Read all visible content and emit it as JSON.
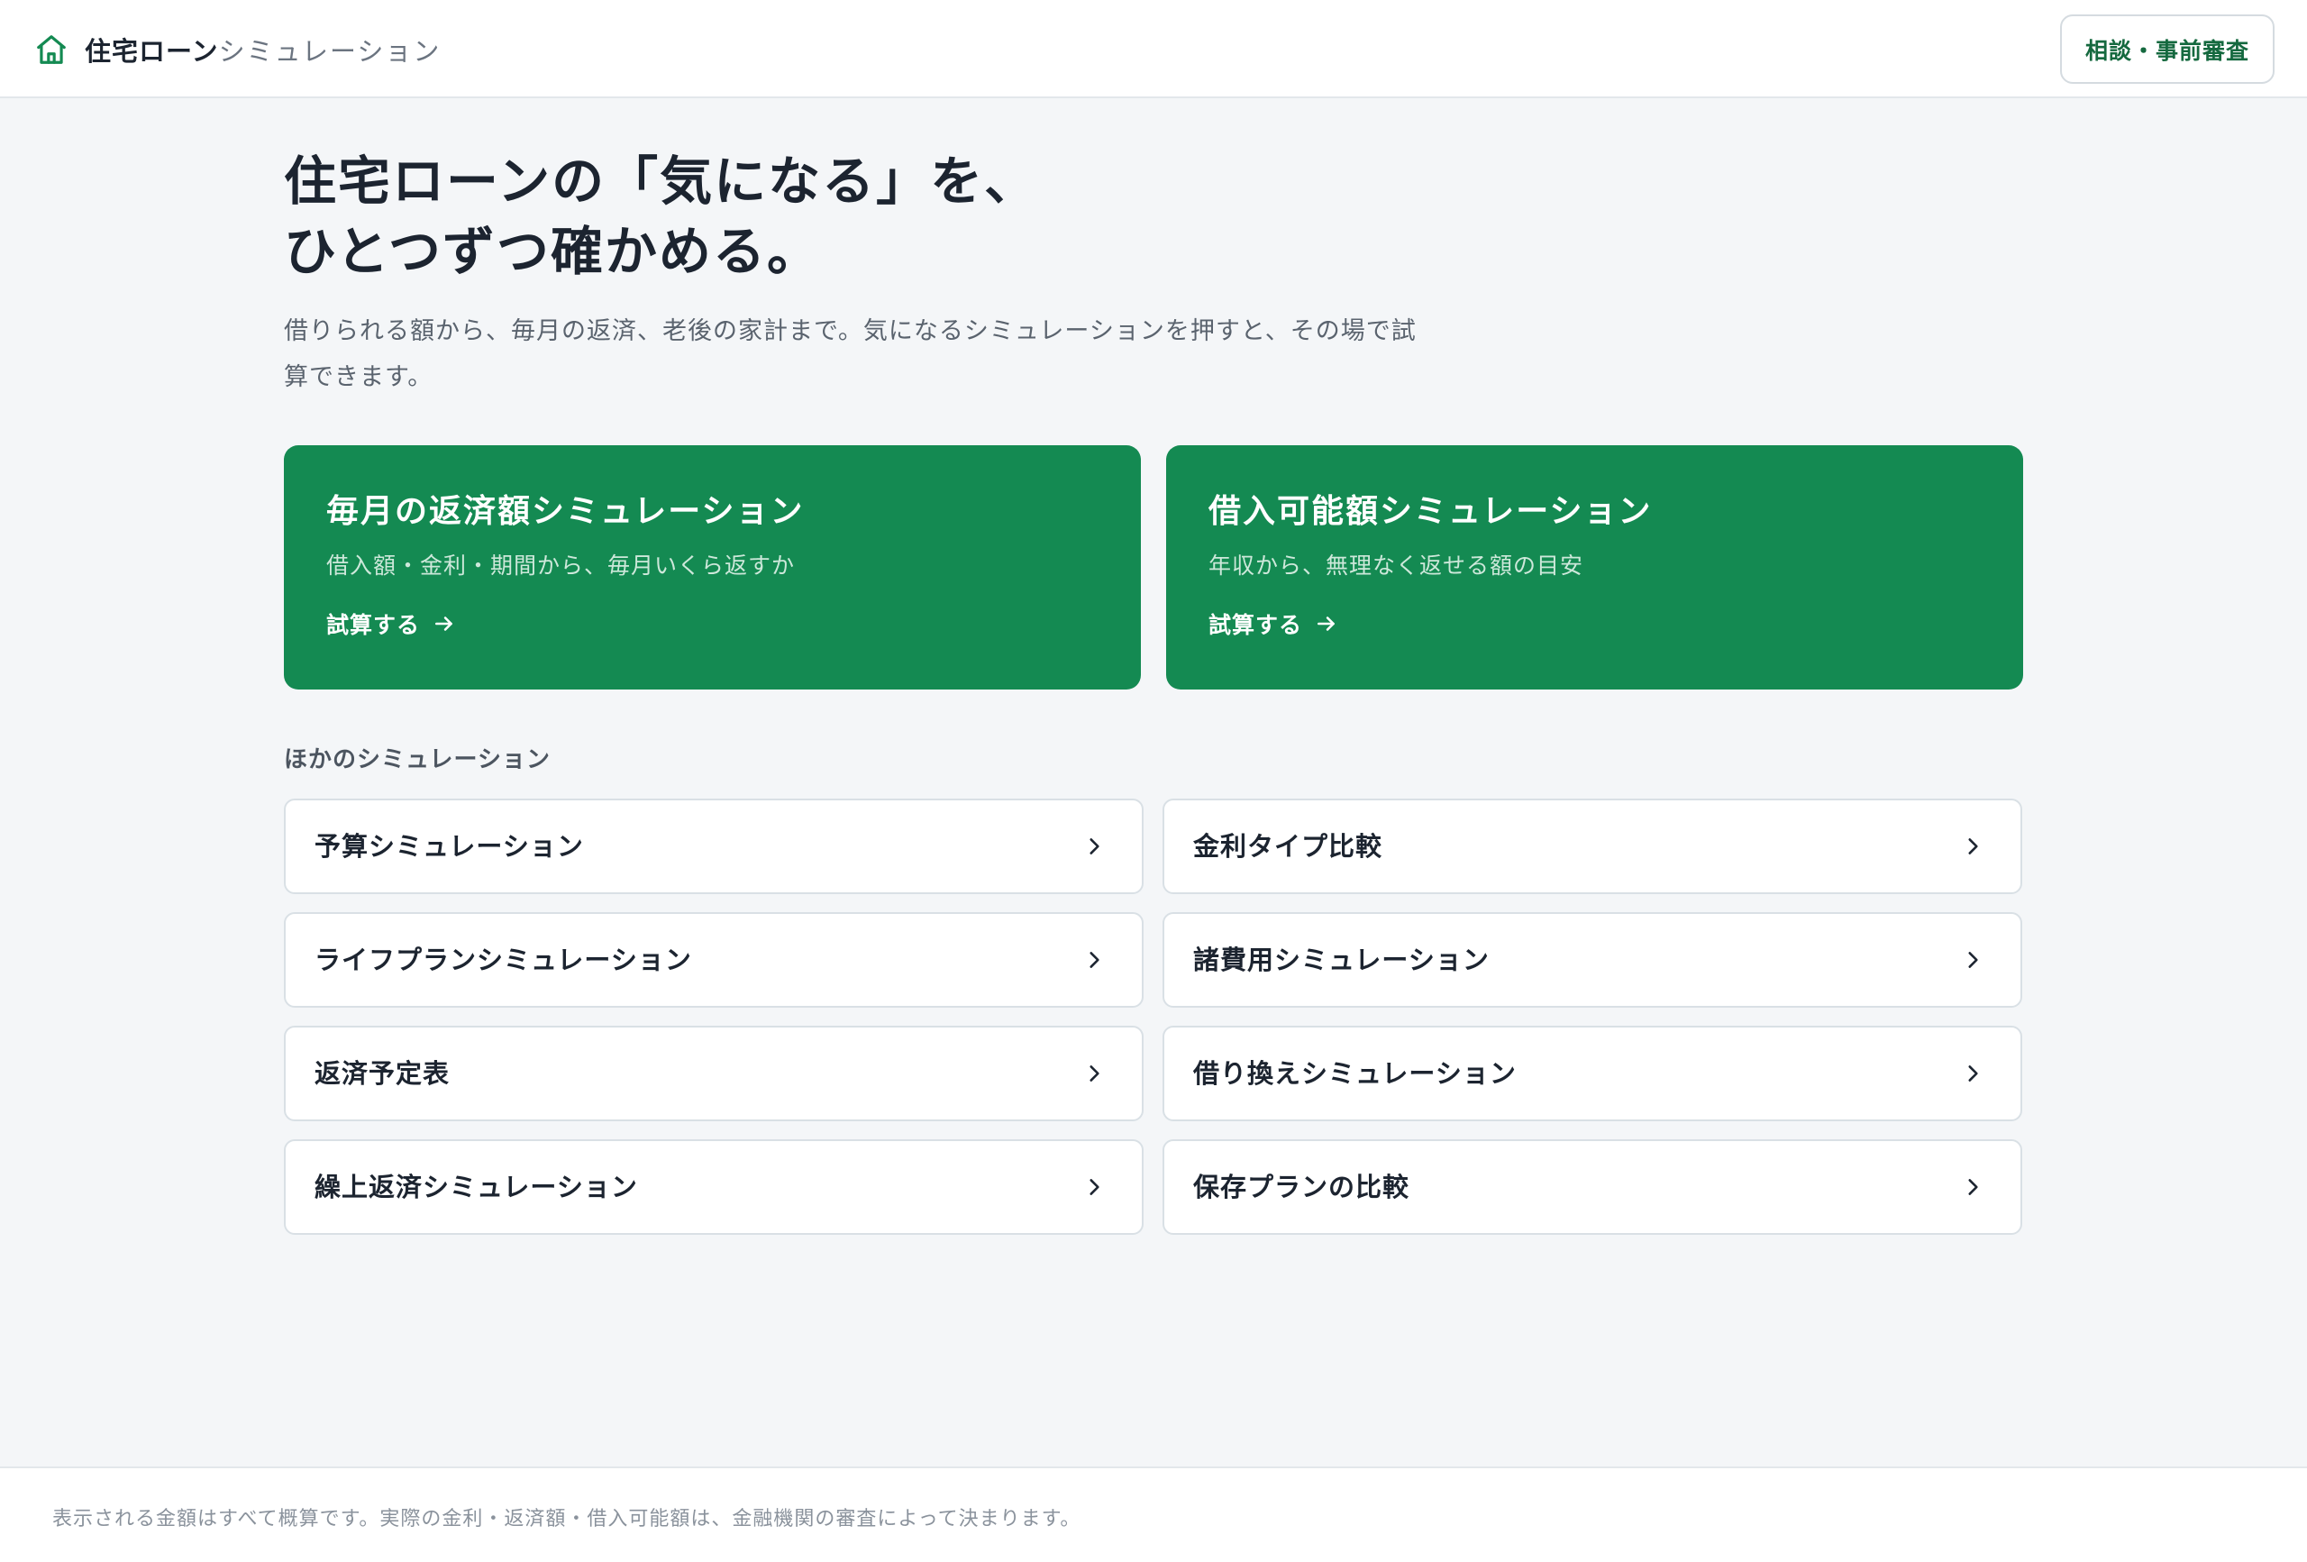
{
  "header": {
    "title_strong": "住宅ローン",
    "title_light": "シミュレーション",
    "home_icon": "home-icon",
    "consult_button": "相談・事前審査"
  },
  "hero": {
    "title_line1": "住宅ローンの「気になる」を、",
    "title_line2": "ひとつずつ確かめる。",
    "description": "借りられる額から、毎月の返済、老後の家計まで。気になるシミュレーションを押すと、その場で試算できます。"
  },
  "featured": [
    {
      "title": "毎月の返済額シミュレーション",
      "subtitle": "借入額・金利・期間から、毎月いくら返すか",
      "cta": "試算する"
    },
    {
      "title": "借入可能額シミュレーション",
      "subtitle": "年収から、無理なく返せる額の目安",
      "cta": "試算する"
    }
  ],
  "others": {
    "label": "ほかのシミュレーション",
    "items": [
      "予算シミュレーション",
      "金利タイプ比較",
      "ライフプランシミュレーション",
      "諸費用シミュレーション",
      "返済予定表",
      "借り換えシミュレーション",
      "繰上返済シミュレーション",
      "保存プランの比較"
    ]
  },
  "footer": {
    "note": "表示される金額はすべて概算です。実際の金利・返済額・借入可能額は、金融機関の審査によって決まります。"
  },
  "colors": {
    "accent": "#148a52",
    "accent_text": "#15693f",
    "background": "#f4f6f8"
  }
}
